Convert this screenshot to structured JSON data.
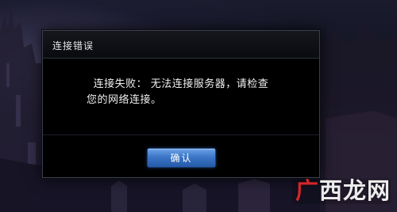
{
  "dialog": {
    "title": "连接错误",
    "message_line1": "连接失败： 无法连接服务器，请检查",
    "message_line2": "您的网络连接。",
    "confirm_label": "确认"
  },
  "watermark": {
    "text": "广西龙网"
  },
  "colors": {
    "button_blue": "#3c76c6",
    "dialog_bg": "#000000",
    "watermark_red": "#d4262b"
  }
}
